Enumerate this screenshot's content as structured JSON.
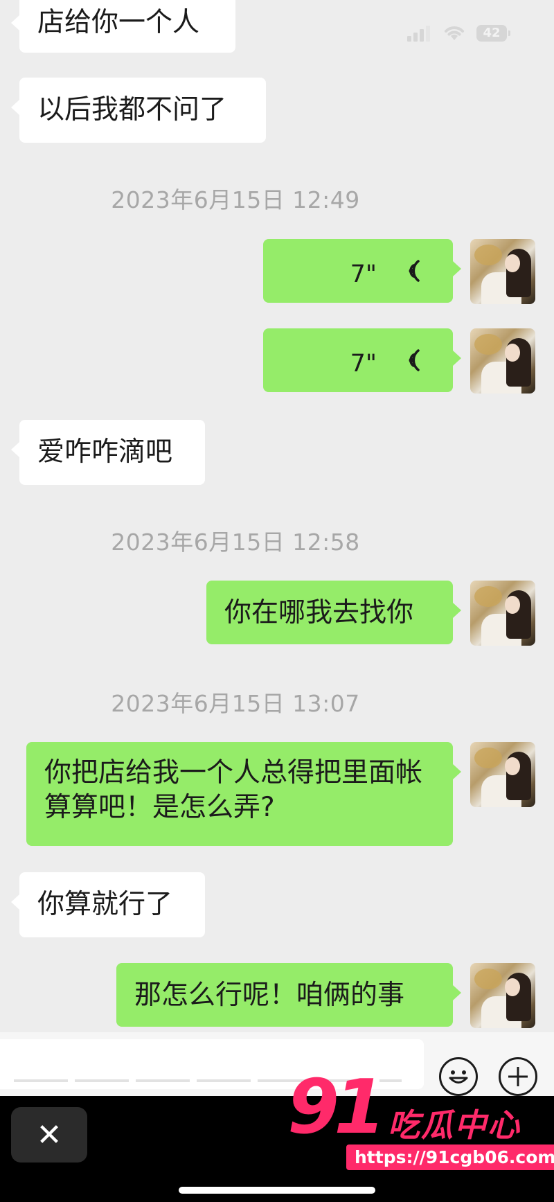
{
  "status_bar": {
    "battery": "42"
  },
  "messages": [
    {
      "type": "incoming",
      "text": "店给你一个人"
    },
    {
      "type": "incoming",
      "text": "以后我都不问了"
    },
    {
      "type": "timestamp",
      "text": "2023年6月15日 12:49"
    },
    {
      "type": "outgoing_voice",
      "duration": "7\""
    },
    {
      "type": "outgoing_voice",
      "duration": "7\""
    },
    {
      "type": "incoming",
      "text": "爱咋咋滴吧"
    },
    {
      "type": "timestamp",
      "text": "2023年6月15日 12:58"
    },
    {
      "type": "outgoing",
      "text": "你在哪我去找你"
    },
    {
      "type": "timestamp",
      "text": "2023年6月15日 13:07"
    },
    {
      "type": "outgoing",
      "text": "你把店给我一个人总得把里面帐算算吧！是怎么弄?"
    },
    {
      "type": "incoming",
      "text": "你算就行了"
    },
    {
      "type": "outgoing",
      "text": "那怎么行呢！咱俩的事"
    }
  ],
  "input_bar": {
    "emoji_icon": "emoji-icon",
    "plus_icon": "plus-icon"
  },
  "bottom_bar": {
    "close_label": "✕"
  },
  "watermark": {
    "number": "91",
    "name": "吃瓜中心",
    "url": "https://91cgb06.com"
  },
  "colors": {
    "chat_bg": "#ededed",
    "outgoing_bubble": "#95ec69",
    "incoming_bubble": "#ffffff",
    "timestamp": "#a7a7a7",
    "watermark": "#ff2a6a"
  }
}
